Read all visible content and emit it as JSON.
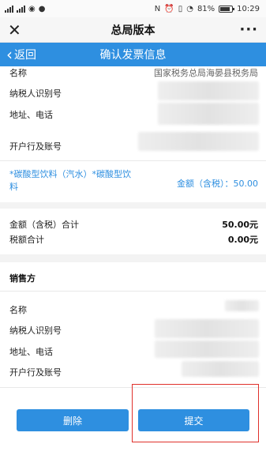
{
  "status_bar": {
    "battery": "81%",
    "time": "10:29",
    "battery_level": 0.81
  },
  "title_bar": {
    "title": "总局版本"
  },
  "nav": {
    "back_label": "返回",
    "title": "确认发票信息"
  },
  "buyer": {
    "name_label": "名称",
    "name_value": "国家税务总局海晏县税务局",
    "tax_id_label": "纳税人识别号",
    "address_label": "地址、电话",
    "bank_label": "开户行及账号"
  },
  "item": {
    "product": "*碳酸型饮料（汽水）*碳酸型饮料",
    "amount": "金额（含税）：50.00"
  },
  "totals": {
    "amount_label": "金额（含税）合计",
    "amount_value": "50.00元",
    "tax_label": "税额合计",
    "tax_value": "0.00元"
  },
  "seller": {
    "section_title": "销售方",
    "name_label": "名称",
    "tax_id_label": "纳税人识别号",
    "address_label": "地址、电话",
    "bank_label": "开户行及账号"
  },
  "actions": {
    "delete_label": "删除",
    "submit_label": "提交"
  },
  "colors": {
    "accent": "#2e8fe0",
    "highlight_box": "#e0302b"
  }
}
